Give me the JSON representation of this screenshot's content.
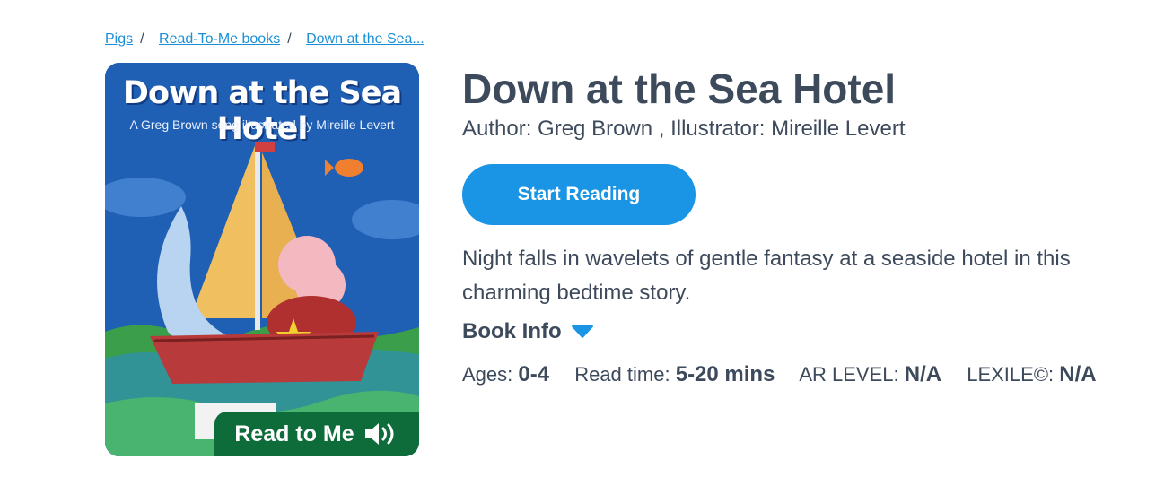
{
  "breadcrumb": {
    "items": [
      "Pigs",
      "Read-To-Me books",
      "Down at the Sea..."
    ],
    "separator": "/"
  },
  "cover": {
    "title": "Down at the Sea Hotel",
    "subtitle": "A Greg Brown song illustrated by Mireille Levert",
    "badge_label": "Read to Me",
    "badge_icon": "speaker-icon",
    "badge_color": "#0e6b3a"
  },
  "book": {
    "title": "Down at the Sea Hotel",
    "authors": "Author: Greg Brown , Illustrator: Mireille Levert",
    "start_button": "Start Reading",
    "description": "Night falls in wavelets of gentle fantasy at a seaside hotel in this charming bedtime story.",
    "book_info_label": "Book Info",
    "book_info_icon": "chevron-down-icon"
  },
  "meta": {
    "ages_label": "Ages:",
    "ages_value": "0-4",
    "readtime_label": "Read time:",
    "readtime_value": "5-20 mins",
    "ar_label": "AR LEVEL:",
    "ar_value": "N/A",
    "lexile_label": "LEXILE©:",
    "lexile_value": "N/A"
  },
  "colors": {
    "accent": "#1a95e6",
    "link": "#1a8fd6",
    "text": "#3d4a5c"
  }
}
